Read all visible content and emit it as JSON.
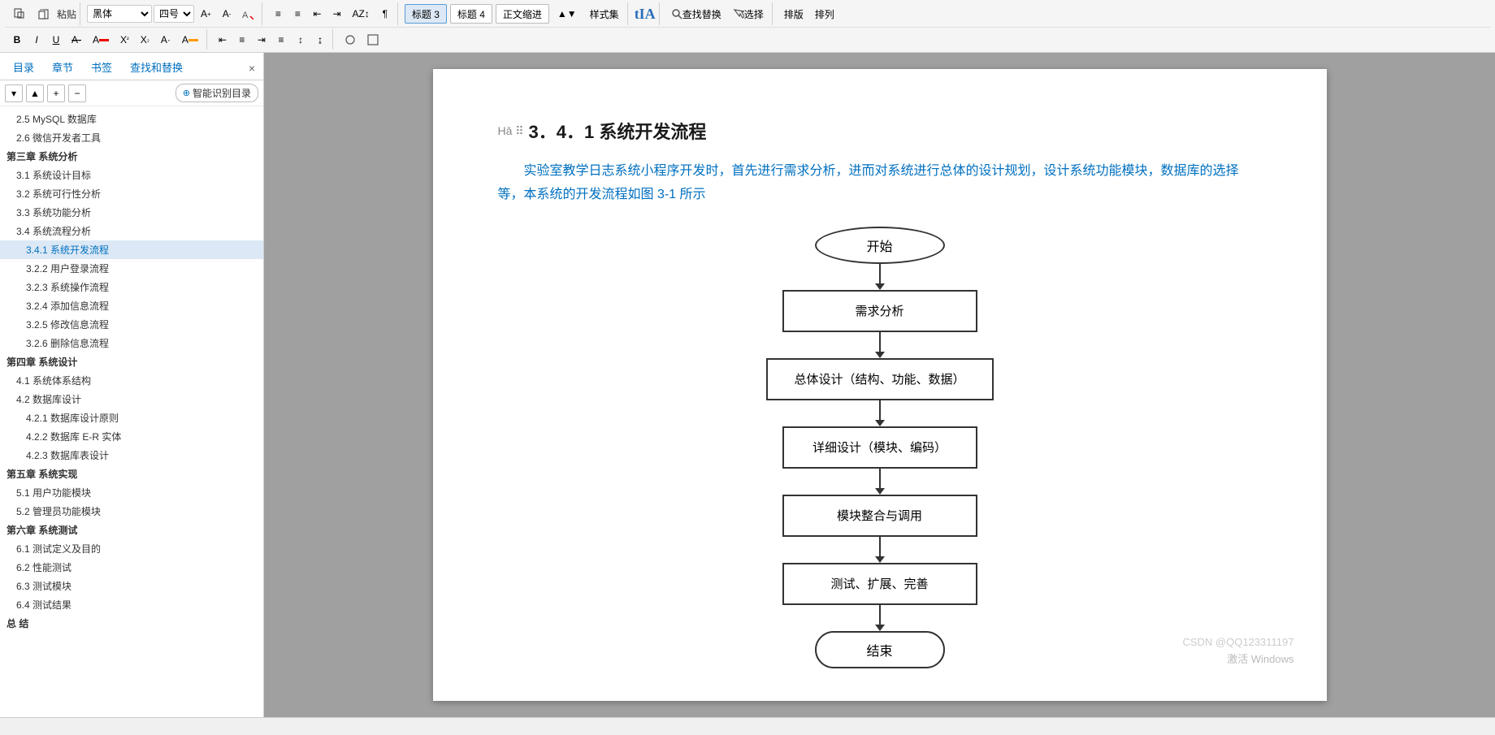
{
  "toolbar": {
    "font_family": "黑体",
    "font_size": "四号",
    "style_buttons": [
      {
        "label": "标题 3",
        "active": false
      },
      {
        "label": "标题 4",
        "active": false
      },
      {
        "label": "正文缩进",
        "active": false
      }
    ],
    "row1_groups": [
      {
        "items": [
          "格式刷",
          "粘贴"
        ]
      },
      {
        "items": [
          "B",
          "I",
          "U",
          "A",
          "A",
          "X²",
          "X₂",
          "A·",
          "A·"
        ]
      },
      {
        "items": [
          "≡",
          "≡",
          "≡",
          "↑↓",
          "↕",
          "AZ"
        ]
      },
      {
        "items": [
          "查找替换",
          "选择",
          "排版",
          "排列"
        ]
      }
    ],
    "find_replace_label": "查找替换",
    "select_label": "选择",
    "style_label": "样式集",
    "typeset_label": "排版",
    "arrange_label": "排列"
  },
  "nav": {
    "tabs": [
      "目录",
      "章节",
      "书签",
      "查找和替换"
    ],
    "close_label": "×",
    "controls": {
      "expand_label": "▾",
      "up_label": "▲",
      "add_label": "+",
      "remove_label": "−",
      "smart_btn_label": "智能识别目录"
    },
    "items": [
      {
        "label": "2.5 MySQL 数据库",
        "level": "level2",
        "id": "nav-mysql"
      },
      {
        "label": "2.6 微信开发者工具",
        "level": "level2",
        "id": "nav-wechat"
      },
      {
        "label": "第三章  系统分析",
        "level": "level1",
        "id": "nav-ch3"
      },
      {
        "label": "3.1  系统设计目标",
        "level": "level2",
        "id": "nav-31"
      },
      {
        "label": "3.2  系统可行性分析",
        "level": "level2",
        "id": "nav-32"
      },
      {
        "label": "3.3  系统功能分析",
        "level": "level2",
        "id": "nav-33"
      },
      {
        "label": "3.4 系统流程分析",
        "level": "level2",
        "id": "nav-34"
      },
      {
        "label": "3.4.1 系统开发流程",
        "level": "level3",
        "id": "nav-341",
        "active": true
      },
      {
        "label": "3.2.2 用户登录流程",
        "level": "level3",
        "id": "nav-322"
      },
      {
        "label": "3.2.3 系统操作流程",
        "level": "level3",
        "id": "nav-323"
      },
      {
        "label": "3.2.4 添加信息流程",
        "level": "level3",
        "id": "nav-324"
      },
      {
        "label": "3.2.5 修改信息流程",
        "level": "level3",
        "id": "nav-325"
      },
      {
        "label": "3.2.6 删除信息流程",
        "level": "level3",
        "id": "nav-326"
      },
      {
        "label": "第四章  系统设计",
        "level": "level1",
        "id": "nav-ch4"
      },
      {
        "label": "4.1  系统体系结构",
        "level": "level2",
        "id": "nav-41"
      },
      {
        "label": "4.2 数据库设计",
        "level": "level2",
        "id": "nav-42"
      },
      {
        "label": "4.2.1  数据库设计原则",
        "level": "level3",
        "id": "nav-421"
      },
      {
        "label": "4.2.2  数据库 E-R 实体",
        "level": "level3",
        "id": "nav-422"
      },
      {
        "label": "4.2.3  数据库表设计",
        "level": "level3",
        "id": "nav-423"
      },
      {
        "label": "第五章  系统实现",
        "level": "level1",
        "id": "nav-ch5"
      },
      {
        "label": "5.1 用户功能模块",
        "level": "level2",
        "id": "nav-51"
      },
      {
        "label": "5.2 管理员功能模块",
        "level": "level2",
        "id": "nav-52"
      },
      {
        "label": "第六章  系统测试",
        "level": "level1",
        "id": "nav-ch6"
      },
      {
        "label": "6.1 测试定义及目的",
        "level": "level2",
        "id": "nav-61"
      },
      {
        "label": "6.2 性能测试",
        "level": "level2",
        "id": "nav-62"
      },
      {
        "label": "6.3 测试模块",
        "level": "level2",
        "id": "nav-63"
      },
      {
        "label": "6.4 测试结果",
        "level": "level2",
        "id": "nav-64"
      },
      {
        "label": "总  结",
        "level": "level1",
        "id": "nav-conclusion"
      }
    ]
  },
  "document": {
    "heading": "3．4．1 系统开发流程",
    "paragraph": "实验室教学日志系统小程序开发时，首先进行需求分析，进而对系统进行总体的设计规划，设计系统功能模块，数据库的选择等，本系统的开发流程如图 3-1 所示",
    "flowchart": {
      "nodes": [
        {
          "type": "oval",
          "label": "开始"
        },
        {
          "type": "rect",
          "label": "需求分析"
        },
        {
          "type": "rect",
          "label": "总体设计（结构、功能、数据）"
        },
        {
          "type": "rect",
          "label": "详细设计（模块、编码）"
        },
        {
          "type": "rect",
          "label": "模块整合与调用"
        },
        {
          "type": "rect",
          "label": "测试、扩展、完善"
        },
        {
          "type": "oval",
          "label": "结束"
        }
      ]
    },
    "watermark_line1": "CSDN @QQ123311197",
    "watermark_line2": "激活 Windows"
  },
  "statusbar": {
    "text": ""
  }
}
